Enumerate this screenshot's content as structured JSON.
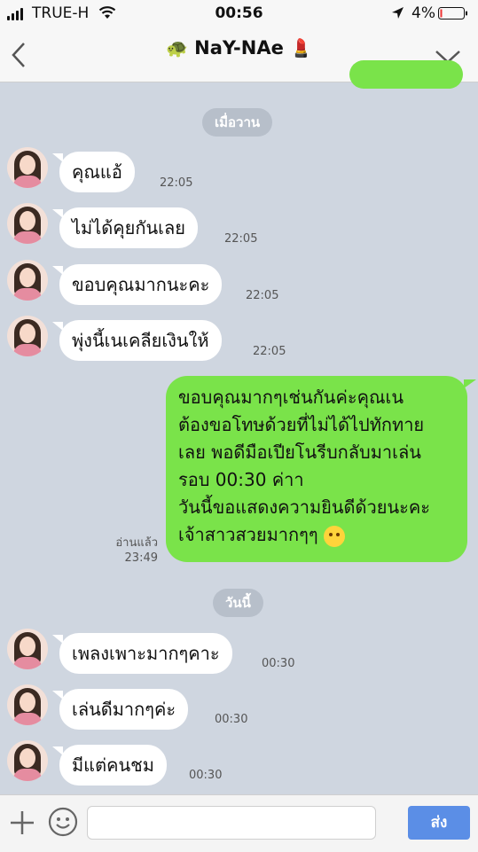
{
  "status_bar": {
    "carrier": "TRUE-H",
    "time": "00:56",
    "battery": "4%"
  },
  "header": {
    "title": "NaY-NAe",
    "title_prefix_emoji": "🐢",
    "title_suffix_emoji": "💄"
  },
  "messages": {
    "date_yesterday": "เมื่อวาน",
    "incoming_1": {
      "text": "คุณแอ้",
      "time": "22:05"
    },
    "incoming_2": {
      "text": "ไม่ได้คุยกันเลย",
      "time": "22:05"
    },
    "incoming_3": {
      "text": "ขอบคุณมากนะคะ",
      "time": "22:05"
    },
    "incoming_4": {
      "text": "พุ่งนี้เนเคลียเงินให้",
      "time": "22:05"
    },
    "outgoing_1": {
      "lines": [
        "ขอบคุณมากๆเช่นกันค่ะคุณเน",
        "ต้องขอโทษด้วยที่ไม่ได้ไปทักทาย",
        "เลย พอดีมือเปียโนรีบกลับมาเล่น",
        "รอบ 00:30 ค่าา",
        "วันนี้ขอแสดงความยินดีด้วยนะคะ",
        "เจ้าสาวสวยมากๆๆ"
      ],
      "read_label": "อ่านแล้ว",
      "time": "23:49"
    },
    "date_today": "วันนี้",
    "incoming_5": {
      "text": "เพลงเพาะมากๆคาะ",
      "time": "00:30"
    },
    "incoming_6": {
      "text": "เล่นดีมากๆค่ะ",
      "time": "00:30"
    },
    "incoming_7": {
      "text": "มีแต่คนชม",
      "time": "00:30"
    }
  },
  "input_bar": {
    "send_label": "ส่ง"
  },
  "colors": {
    "outgoing_bubble": "#7ae34a",
    "incoming_bubble": "#ffffff",
    "chat_background": "#cfd6e0",
    "send_button": "#5b8ee6"
  }
}
